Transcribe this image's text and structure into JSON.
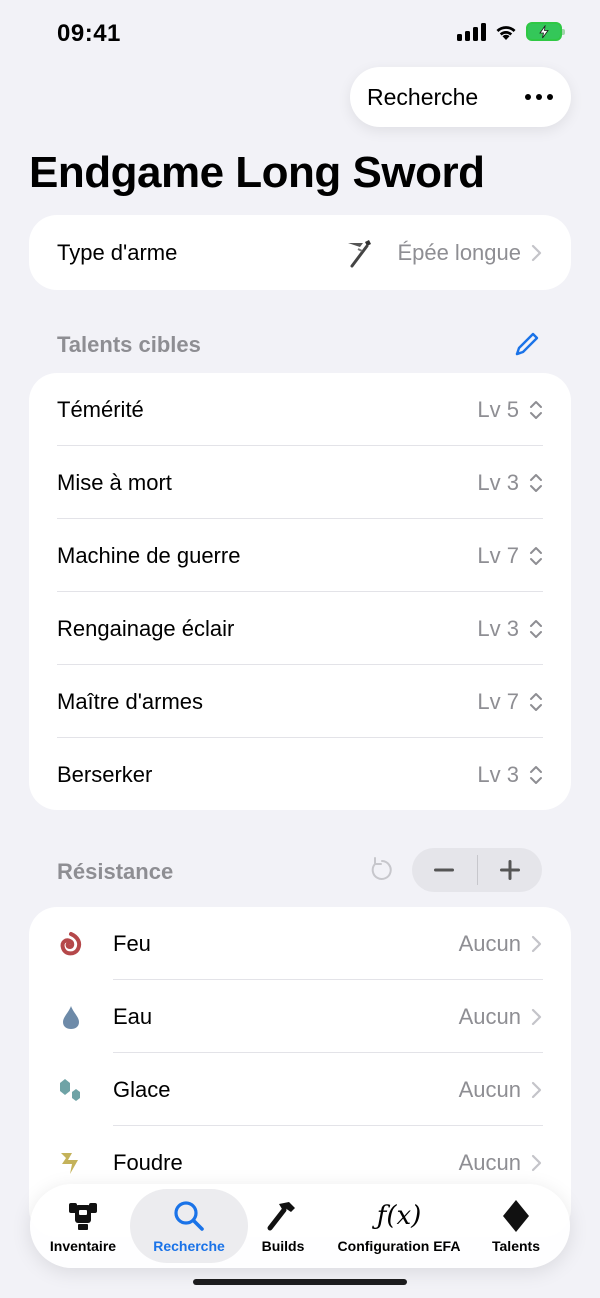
{
  "status_bar": {
    "time": "09:41"
  },
  "nav": {
    "pill_label": "Recherche",
    "more_icon": "ellipsis-icon"
  },
  "page_title": "Endgame Long Sword",
  "weapon_type": {
    "label": "Type d'arme",
    "value": "Épée longue",
    "icon": "long-sword-icon"
  },
  "target_talents": {
    "header": "Talents cibles",
    "edit_icon": "pencil-icon",
    "items": [
      {
        "label": "Témérité",
        "level": "Lv 5"
      },
      {
        "label": "Mise à mort",
        "level": "Lv 3"
      },
      {
        "label": "Machine de guerre",
        "level": "Lv 7"
      },
      {
        "label": "Rengainage éclair",
        "level": "Lv 3"
      },
      {
        "label": "Maître d'armes",
        "level": "Lv 7"
      },
      {
        "label": "Berserker",
        "level": "Lv 3"
      }
    ]
  },
  "resistance": {
    "header": "Résistance",
    "items": [
      {
        "label": "Feu",
        "value": "Aucun",
        "icon": "fire-icon",
        "color": "#b5484a"
      },
      {
        "label": "Eau",
        "value": "Aucun",
        "icon": "water-icon",
        "color": "#6d8aa8"
      },
      {
        "label": "Glace",
        "value": "Aucun",
        "icon": "ice-icon",
        "color": "#6fa3a6"
      },
      {
        "label": "Foudre",
        "value": "Aucun",
        "icon": "thunder-icon",
        "color": "#c4b25a"
      }
    ]
  },
  "tab_bar": {
    "tabs": [
      {
        "label": "Inventaire",
        "icon": "armor-icon"
      },
      {
        "label": "Recherche",
        "icon": "search-icon",
        "active": true
      },
      {
        "label": "Builds",
        "icon": "hammer-icon"
      },
      {
        "label": "Configuration EFA",
        "icon": "function-icon"
      },
      {
        "label": "Talents",
        "icon": "diamond-icon"
      }
    ]
  },
  "colors": {
    "accent": "#1a73e8",
    "background": "#f2f2f7",
    "secondary_text": "#8e8e93"
  }
}
